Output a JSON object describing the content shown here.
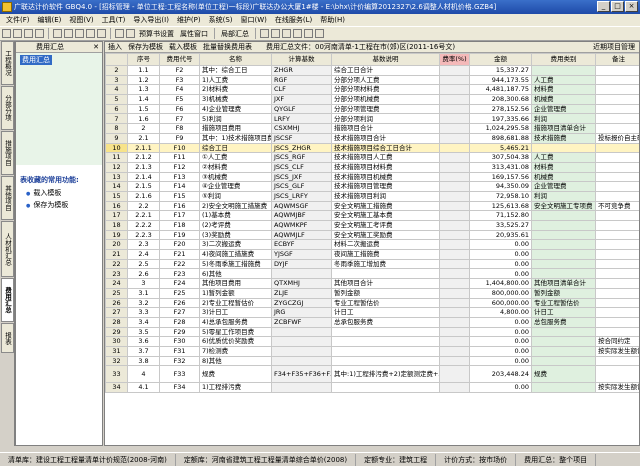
{
  "titlebar": {
    "title": "广联达计价软件 GBQ4.0 - [招标管理 - 单位工程:工程名称(单位工程)一标段)广联达办公大厦1#楼 - E:\\bhx\\计价编算2012327\\2.6调整人材机价格.GZB4]",
    "buttons": [
      "_",
      "□",
      "×"
    ]
  },
  "menu": [
    "文件(F)",
    "编辑(E)",
    "视图(V)",
    "工具(T)",
    "导入导出(I)",
    "维护(P)",
    "系统(S)",
    "窗口(W)",
    "在线服务(L)",
    "帮助(H)"
  ],
  "toolbar": {
    "items": [
      "预算书设置",
      "属性窗口",
      "局部汇总",
      "近期项目管理"
    ]
  },
  "left_tabs": [
    "工程概况",
    "分部分项",
    "措施项目",
    "其他项目",
    "人材机汇总",
    "费用汇总",
    "报表"
  ],
  "left_panel": {
    "header": "费用汇总",
    "close": "✕",
    "tree_item": "费用汇总",
    "fav_title": "表收藏的常用功能:",
    "fav_items": [
      "载入模板",
      "保存为模板"
    ]
  },
  "subtoolbar": {
    "items": [
      "插入",
      "保存为模板",
      "载入模板",
      "批量替换费用表"
    ],
    "path": "费用汇总文件：00河南清单-1工程在市(郊)区(2011-16号文)",
    "right_btn": "近期项目管理"
  },
  "columns": [
    "",
    "序号",
    "费用代号",
    "名称",
    "计算基数",
    "基数说明",
    "费率(%)",
    "金额",
    "费用类别",
    "备注"
  ],
  "rows": [
    [
      "2",
      "1.1",
      "F2",
      "其中：综合工日",
      "ZHGR",
      "综合工日合计",
      "",
      "15,337.27",
      "",
      ""
    ],
    [
      "3",
      "1.2",
      "F3",
      "1)人工费",
      "RGF",
      "分部分项人工费",
      "",
      "944,173.55",
      "人工费",
      ""
    ],
    [
      "4",
      "1.3",
      "F4",
      "2)材料费",
      "CLF",
      "分部分项材料费",
      "",
      "4,481,187.75",
      "材料费",
      ""
    ],
    [
      "5",
      "1.4",
      "F5",
      "3)机械费",
      "JXF",
      "分部分项机械费",
      "",
      "208,300.68",
      "机械费",
      ""
    ],
    [
      "6",
      "1.5",
      "F6",
      "4)企业管理费",
      "QYGLF",
      "分部分项管理费",
      "",
      "278,152.56",
      "企业管理费",
      ""
    ],
    [
      "7",
      "1.6",
      "F7",
      "5)利润",
      "LRFY",
      "分部分项利润",
      "",
      "197,335.66",
      "利润",
      ""
    ],
    [
      "8",
      "2",
      "F8",
      "措施项目费用",
      "CSXMHJ",
      "措施项目合计",
      "",
      "1,024,295.58",
      "措施项目清单合计",
      ""
    ],
    [
      "9",
      "2.1",
      "F9",
      "其中：1)技术措施项目费",
      "JSCSF",
      "技术措施项目合计",
      "",
      "898,681.88",
      "技术措施费",
      "投标报价自主确定"
    ],
    [
      "10",
      "2.1.1",
      "F10",
      "综合工日",
      "JSCS_ZHGR",
      "技术措施项目综合工日合计",
      "",
      "5,465.21",
      "",
      ""
    ],
    [
      "11",
      "2.1.2",
      "F11",
      "①人工费",
      "JSCS_RGF",
      "技术措施项目人工费",
      "",
      "307,504.38",
      "人工费",
      ""
    ],
    [
      "12",
      "2.1.3",
      "F12",
      "②材料费",
      "JSCS_CLF",
      "技术措施项目材料费",
      "",
      "313,431.08",
      "材料费",
      ""
    ],
    [
      "13",
      "2.1.4",
      "F13",
      "③机械费",
      "JSCS_JXF",
      "技术措施项目机械费",
      "",
      "169,157.56",
      "机械费",
      ""
    ],
    [
      "14",
      "2.1.5",
      "F14",
      "④企业管理费",
      "JSCS_GLF",
      "技术措施项目管理费",
      "",
      "94,350.09",
      "企业管理费",
      ""
    ],
    [
      "15",
      "2.1.6",
      "F15",
      "⑤利润",
      "JSCS_LRFY",
      "技术措施项目利润",
      "",
      "72,958.10",
      "利润",
      ""
    ],
    [
      "16",
      "2.2",
      "F16",
      "2)安全文明施工措施费",
      "AQWMSGF",
      "安全文明施工措施费",
      "",
      "125,613.68",
      "安全文明施工专项费",
      "不可竞争费"
    ],
    [
      "17",
      "2.2.1",
      "F17",
      "(1)基本费",
      "AQWMJBF",
      "安全文明施工基本费",
      "",
      "71,152.80",
      "",
      ""
    ],
    [
      "18",
      "2.2.2",
      "F18",
      "(2)考评费",
      "AQWMKPF",
      "安全文明施工考评费",
      "",
      "33,525.27",
      "",
      ""
    ],
    [
      "19",
      "2.2.3",
      "F19",
      "(3)奖励费",
      "AQWMJLF",
      "安全文明施工奖励费",
      "",
      "20,935.61",
      "",
      ""
    ],
    [
      "20",
      "2.3",
      "F20",
      "3)二次搬运费",
      "ECBYF",
      "材料二次搬运费",
      "",
      "0.00",
      "",
      ""
    ],
    [
      "21",
      "2.4",
      "F21",
      "4)夜间施工措施费",
      "YJSGF",
      "夜间施工措施费",
      "",
      "0.00",
      "",
      ""
    ],
    [
      "22",
      "2.5",
      "F22",
      "5)冬雨季施工措施费",
      "DYJF",
      "冬雨季施工增加费",
      "",
      "0.00",
      "",
      ""
    ],
    [
      "23",
      "2.6",
      "F23",
      "6)其他",
      "",
      "",
      "",
      "0.00",
      "",
      ""
    ],
    [
      "24",
      "3",
      "F24",
      "其他项目费用",
      "QTXMHJ",
      "其他项目合计",
      "",
      "1,404,800.00",
      "其他项目清单合计",
      ""
    ],
    [
      "25",
      "3.1",
      "F25",
      "1)暂列金额",
      "ZLJE",
      "暂列金额",
      "",
      "800,000.00",
      "暂列金额",
      ""
    ],
    [
      "26",
      "3.2",
      "F26",
      "2)专业工程暂估价",
      "ZYGCZGJ",
      "专业工程暂估价",
      "",
      "600,000.00",
      "专业工程暂估价",
      ""
    ],
    [
      "27",
      "3.3",
      "F27",
      "3)计日工",
      "JRG",
      "计日工",
      "",
      "4,800.00",
      "计日工",
      ""
    ],
    [
      "28",
      "3.4",
      "F28",
      "4)总承包服务费",
      "ZCBFWF",
      "总承包服务费",
      "",
      "0.00",
      "总包服务费",
      ""
    ],
    [
      "29",
      "3.5",
      "F29",
      "5)零星工作项目费",
      "",
      "",
      "",
      "0.00",
      "",
      ""
    ],
    [
      "30",
      "3.6",
      "F30",
      "6)优质优价奖励费",
      "",
      "",
      "",
      "0.00",
      "",
      "按合同约定"
    ],
    [
      "31",
      "3.7",
      "F31",
      "7)检测费",
      "",
      "",
      "",
      "0.00",
      "",
      "按实际发生额计算"
    ],
    [
      "32",
      "3.8",
      "F32",
      "8)其他",
      "",
      "",
      "",
      "0.00",
      "",
      ""
    ],
    [
      "33",
      "4",
      "F33",
      "规费",
      "F34+F35+F36+F37+F38",
      "其中:1)工程排污费+2)定额测定费+3)社会保障费+4)住房公积金+5)意外伤害保险",
      "",
      "203,448.24",
      "规费",
      ""
    ],
    [
      "34",
      "4.1",
      "F34",
      "1)工程排污费",
      "",
      "",
      "",
      "0.00",
      "",
      "按实际发生额计算"
    ]
  ],
  "statusbar": [
    "清单库：建设工程工程量清单计价规范(2008-河南)",
    "定额库：河南省建筑工程工程量清单综合单价(2008)",
    "定额专业：建筑工程",
    "计价方式：按市场价",
    "费用汇总：整个项目"
  ]
}
